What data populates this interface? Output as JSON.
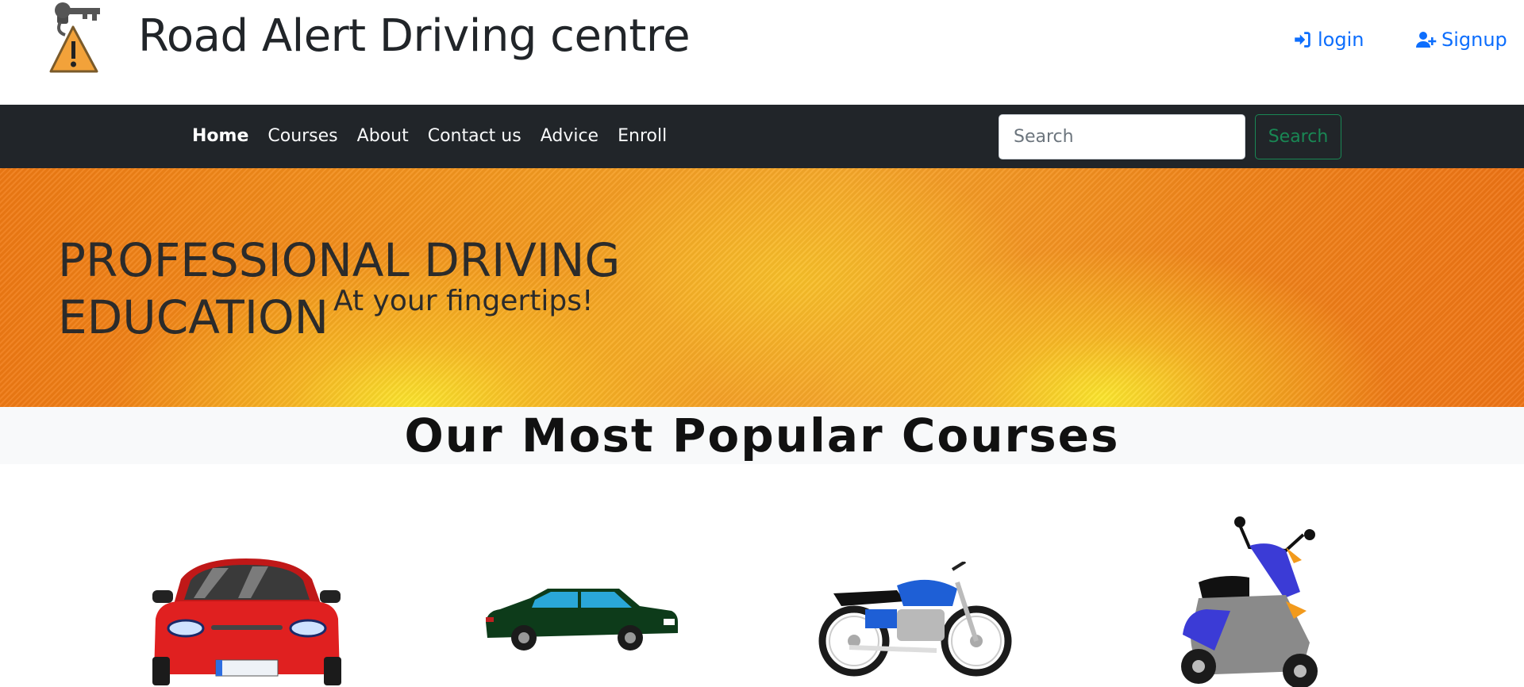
{
  "header": {
    "site_title": "Road Alert Driving centre",
    "login_label": "login",
    "signup_label": "Signup",
    "logo_icon": "warning-key-icon",
    "link_color": "#0d6efd"
  },
  "navbar": {
    "items": [
      {
        "label": "Home",
        "active": true
      },
      {
        "label": "Courses"
      },
      {
        "label": "About"
      },
      {
        "label": "Contact us"
      },
      {
        "label": "Advice"
      },
      {
        "label": "Enroll"
      }
    ],
    "search_placeholder": "Search",
    "search_button_label": "Search",
    "background": "#212529",
    "search_button_color": "#198754"
  },
  "hero": {
    "heading_line1": "PROFESSIONAL DRIVING",
    "heading_line2": "EDUCATION",
    "subheading": "At your fingertips!"
  },
  "courses": {
    "title": "Our Most Popular Courses",
    "items": [
      {
        "icon": "red-car-icon"
      },
      {
        "icon": "green-sedan-icon"
      },
      {
        "icon": "motorcycle-icon"
      },
      {
        "icon": "scooter-icon"
      }
    ]
  }
}
